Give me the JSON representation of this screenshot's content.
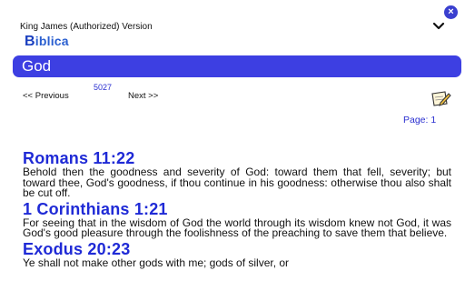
{
  "header": {
    "close_glyph": "×",
    "version_label": "King James (Authorized) Version",
    "chevron_icon": "chevron-down-icon"
  },
  "logo": {
    "first": "B",
    "rest": "iblica"
  },
  "search": {
    "value": "God",
    "bg_color": "#3d3fe2"
  },
  "pager": {
    "result_count": "5027",
    "prev_label": "<< Previous",
    "next_label": "Next >>",
    "page_label": "Page: 1",
    "edit_icon": "notepad-pencil-icon"
  },
  "results": [
    {
      "reference": "Romans 11:22",
      "text": "Behold then the goodness and severity of God: toward them that fell, severity; but toward thee, God's goodness, if thou continue in his goodness: otherwise thou also shalt be cut off."
    },
    {
      "reference": "1 Corinthians 1:21",
      "text": "For seeing that in the wisdom of God the world through its wisdom knew not God, it was God's good pleasure through the foolishness of the preaching to save them that believe."
    },
    {
      "reference": "Exodus 20:23",
      "text": "Ye shall not make other gods with me; gods of silver, or"
    }
  ],
  "colors": {
    "accent": "#3d3fe2",
    "link": "#1f2ad6"
  }
}
